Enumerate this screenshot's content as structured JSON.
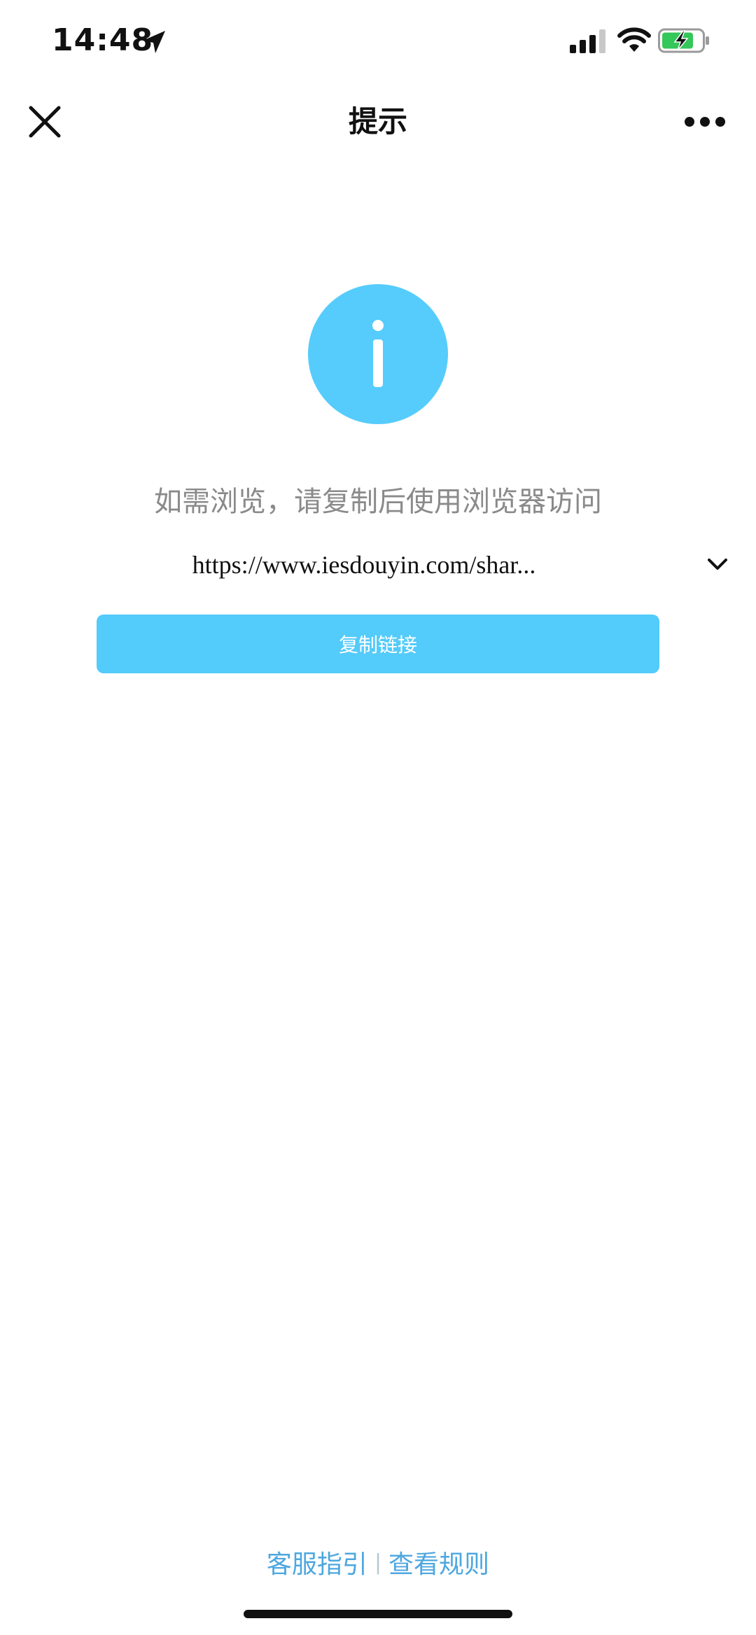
{
  "status_bar": {
    "time": "14:48"
  },
  "nav": {
    "title": "提示"
  },
  "content": {
    "message": "如需浏览，请复制后使用浏览器访问",
    "url": "https://www.iesdouyin.com/shar...",
    "copy_button_label": "复制链接"
  },
  "footer": {
    "guide_link": "客服指引",
    "separator": "|",
    "rules_link": "查看规则"
  },
  "colors": {
    "accent": "#55CCFC",
    "link": "#4DA7DF",
    "message_text": "#8a8a8a"
  },
  "icons": [
    "location-arrow-icon",
    "signal-icon",
    "wifi-icon",
    "battery-charging-icon",
    "close-icon",
    "more-icon",
    "info-icon",
    "chevron-down-icon"
  ]
}
